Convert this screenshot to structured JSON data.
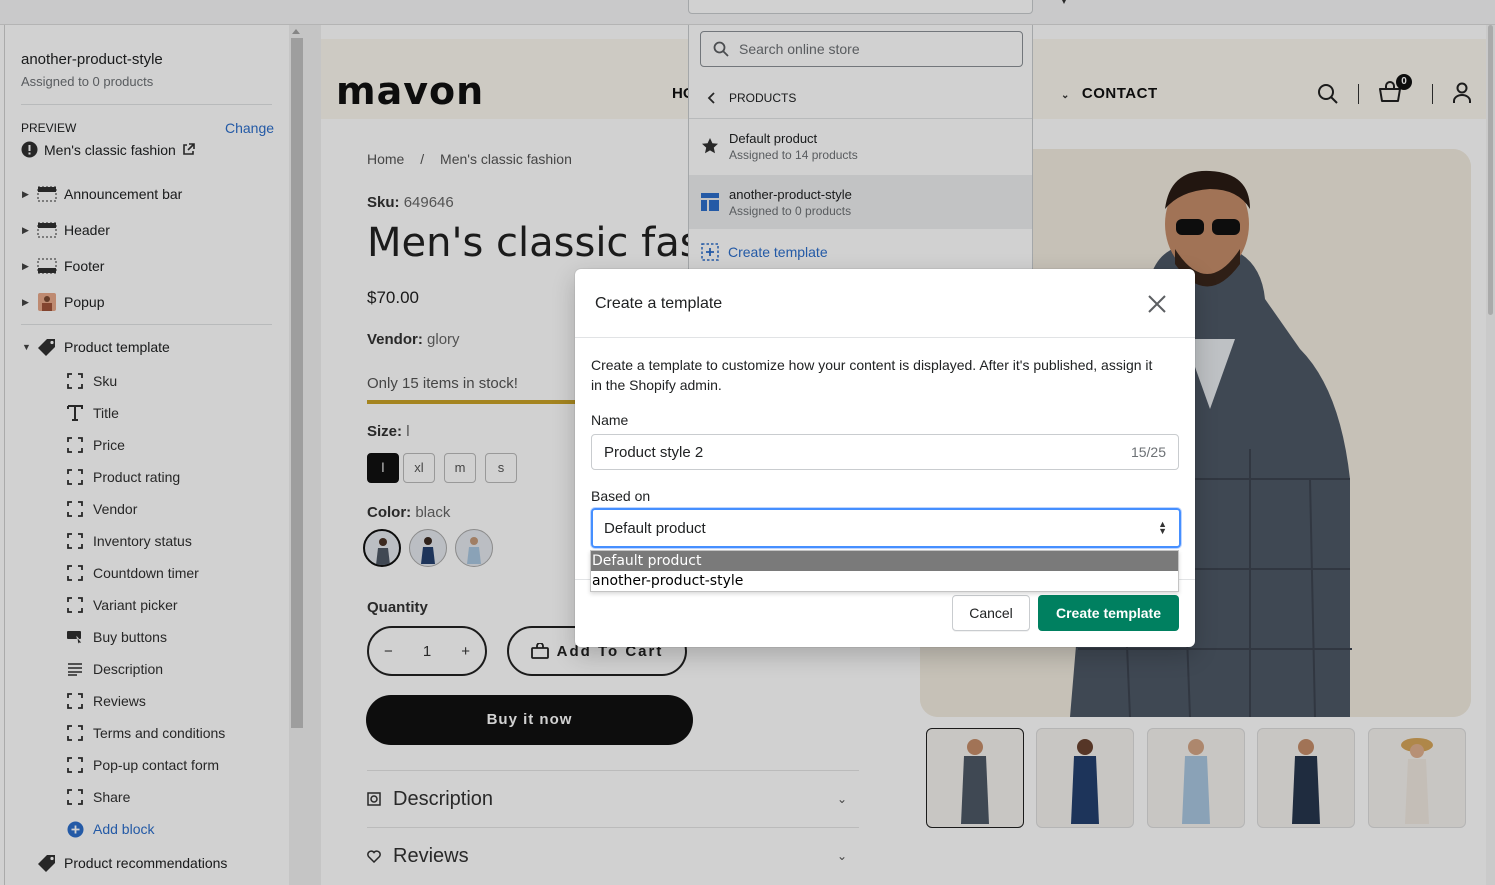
{
  "sidebar": {
    "template_name": "another-product-style",
    "template_sub": "Assigned to 0 products",
    "preview_label": "PREVIEW",
    "change_label": "Change",
    "preview_item": "Men's classic fashion",
    "sections": [
      {
        "label": "Announcement bar"
      },
      {
        "label": "Header"
      },
      {
        "label": "Footer"
      },
      {
        "label": "Popup"
      },
      {
        "label": "Product template"
      }
    ],
    "blocks": [
      {
        "label": "Sku"
      },
      {
        "label": "Title"
      },
      {
        "label": "Price"
      },
      {
        "label": "Product rating"
      },
      {
        "label": "Vendor"
      },
      {
        "label": "Inventory status"
      },
      {
        "label": "Countdown timer"
      },
      {
        "label": "Variant picker"
      },
      {
        "label": "Buy buttons"
      },
      {
        "label": "Description"
      },
      {
        "label": "Reviews"
      },
      {
        "label": "Terms and conditions"
      },
      {
        "label": "Pop-up contact form"
      },
      {
        "label": "Share"
      }
    ],
    "add_block": "Add block",
    "recommendations": "Product recommendations"
  },
  "store": {
    "logo": "mavon",
    "nav_partial": "HO",
    "nav_contact": "CONTACT",
    "cart_count": "0",
    "breadcrumb_home": "Home",
    "breadcrumb_sep": "/",
    "breadcrumb_current": "Men's classic fashion",
    "sku_label": "Sku:",
    "sku_value": "649646",
    "title": "Men's classic fas",
    "price": "$70.00",
    "vendor_label": "Vendor:",
    "vendor_value": "glory",
    "stock_text": "Only 15 items in stock!",
    "size_label": "Size:",
    "size_value": "l",
    "sizes": [
      "l",
      "xl",
      "m",
      "s"
    ],
    "color_label": "Color:",
    "color_value": "black",
    "qty_label": "Quantity",
    "qty_value": "1",
    "qty_minus": "−",
    "qty_plus": "+",
    "add_to_cart": "Add To Cart",
    "buy_now": "Buy it now",
    "acc_description": "Description",
    "acc_reviews": "Reviews"
  },
  "template_dropdown": {
    "search_placeholder": "Search online store",
    "back_label": "PRODUCTS",
    "items": [
      {
        "title": "Default product",
        "sub": "Assigned to 14 products"
      },
      {
        "title": "another-product-style",
        "sub": "Assigned to 0 products"
      }
    ],
    "create_label": "Create template"
  },
  "modal": {
    "title": "Create a template",
    "description": "Create a template to customize how your content is displayed. After it's published, assign it in the Shopify admin.",
    "name_label": "Name",
    "name_value": "Product style 2",
    "name_counter": "15/25",
    "based_on_label": "Based on",
    "based_on_value": "Default product",
    "options": [
      "Default product",
      "another-product-style"
    ],
    "cancel_label": "Cancel",
    "create_label": "Create template"
  },
  "colors": {
    "primary_green": "#008060",
    "link_blue": "#2c6ecb",
    "focus_blue": "#458fff"
  }
}
